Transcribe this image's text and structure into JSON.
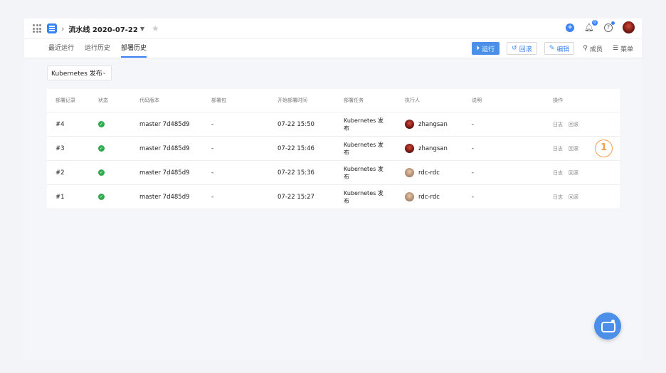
{
  "header": {
    "pipeline_title": "流水线 2020-07-22",
    "notification_count": "0"
  },
  "tabs": [
    {
      "label": "最近运行"
    },
    {
      "label": "运行历史"
    },
    {
      "label": "部署历史",
      "active": true
    }
  ],
  "actions": {
    "run": "运行",
    "rollback": "回滚",
    "edit": "编辑",
    "members": "成员",
    "menu": "菜单"
  },
  "filter": {
    "selected": "Kubernetes 发布"
  },
  "table": {
    "columns": [
      "部署记录",
      "状态",
      "代码版本",
      "部署包",
      "开始部署时间",
      "部署任务",
      "执行人",
      "说明",
      "操作"
    ],
    "rows": [
      {
        "id": "#4",
        "version": "master  7d485d9",
        "package": "-",
        "start_time": "07-22 15:50",
        "task": "Kubernetes 发布",
        "executor": "zhangsan",
        "note": "-",
        "op_log": "日志",
        "op_rollback": "回滚"
      },
      {
        "id": "#3",
        "version": "master  7d485d9",
        "package": "-",
        "start_time": "07-22 15:46",
        "task": "Kubernetes 发布",
        "executor": "zhangsan",
        "note": "-",
        "op_log": "日志",
        "op_rollback": "回滚"
      },
      {
        "id": "#2",
        "version": "master  7d485d9",
        "package": "-",
        "start_time": "07-22 15:36",
        "task": "Kubernetes 发布",
        "executor": "rdc-rdc",
        "note": "-",
        "op_log": "日志",
        "op_rollback": "回滚"
      },
      {
        "id": "#1",
        "version": "master  7d485d9",
        "package": "-",
        "start_time": "07-22 15:27",
        "task": "Kubernetes 发布",
        "executor": "rdc-rdc",
        "note": "-",
        "op_log": "日志",
        "op_rollback": "回滚"
      }
    ]
  },
  "marker": {
    "label": "1"
  },
  "colors": {
    "accent": "#4b8fe8",
    "success": "#2faa4e",
    "marker": "#f0a04b"
  }
}
